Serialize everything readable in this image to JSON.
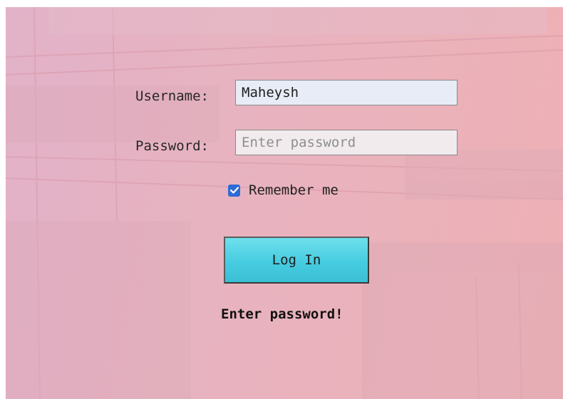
{
  "form": {
    "username_label": "Username:",
    "username_value": "Maheysh",
    "password_label": "Password:",
    "password_placeholder": "Enter password",
    "remember_label": "Remember me",
    "remember_checked": true,
    "login_label": "Log In",
    "message": "Enter password!"
  },
  "colors": {
    "background_tint": "#e9b3c1",
    "button": "#46cce0",
    "checkbox": "#2f6bd4"
  },
  "icons": {
    "checkbox": "checkmark-icon"
  }
}
